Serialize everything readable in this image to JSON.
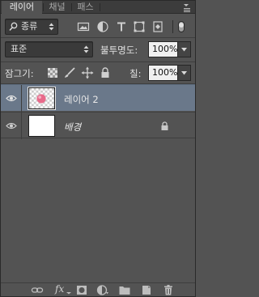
{
  "tabs": [
    {
      "label": "레이어",
      "active": true
    },
    {
      "label": "채널",
      "active": false
    },
    {
      "label": "패스",
      "active": false
    }
  ],
  "filter": {
    "kind_label": "종류",
    "icons": [
      "image-filter-icon",
      "adjustment-filter-icon",
      "type-filter-icon",
      "shape-filter-icon",
      "smart-object-filter-icon"
    ]
  },
  "blend": {
    "mode": "표준",
    "opacity_label": "불투명도:",
    "opacity_value": "100%"
  },
  "lock_row": {
    "label": "잠그기:",
    "fill_label": "칠:",
    "fill_value": "100%"
  },
  "layers": [
    {
      "name": "레이어 2",
      "selected": true,
      "italic": false,
      "locked": false
    },
    {
      "name": "배경",
      "selected": false,
      "italic": true,
      "locked": true
    }
  ],
  "colors": {
    "panel_bg": "#535353",
    "selected_layer": "#6a788a",
    "text": "#e0e0e0"
  }
}
